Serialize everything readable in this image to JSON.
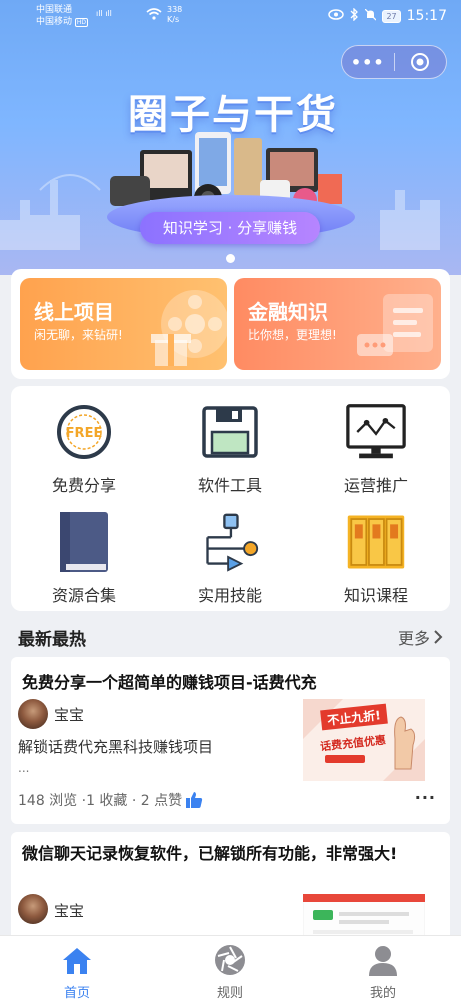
{
  "status_bar": {
    "carrier_1": "中国联通",
    "carrier_2": "中国移动",
    "hd": "HD",
    "speed_value": "338",
    "speed_unit": "K/s",
    "battery": "27",
    "time": "15:17"
  },
  "capsule": {
    "more_label": "•••"
  },
  "banner": {
    "title": "圈子与干货",
    "slogan": "知识学习 · 分享赚钱"
  },
  "promos": [
    {
      "title": "线上项目",
      "subtitle": "闲无聊，来钻研!"
    },
    {
      "title": "金融知识",
      "subtitle": "比你想，更理想!"
    }
  ],
  "categories": [
    {
      "label": "免费分享",
      "icon": "free-badge-icon",
      "badge": "FREE"
    },
    {
      "label": "软件工具",
      "icon": "floppy-disk-icon"
    },
    {
      "label": "运营推广",
      "icon": "monitor-chart-icon"
    },
    {
      "label": "资源合集",
      "icon": "book-icon"
    },
    {
      "label": "实用技能",
      "icon": "flowchart-icon"
    },
    {
      "label": "知识课程",
      "icon": "file-folders-icon"
    }
  ],
  "section": {
    "title": "最新最热",
    "more": "更多"
  },
  "articles": [
    {
      "title": "免费分享一个超简单的赚钱项目-话费代充",
      "author": "宝宝",
      "description": "解锁话费代充黑科技赚钱项目",
      "ellipsis": "...",
      "stats": "148 浏览 ·1 收藏 · 2 点赞",
      "thumb_text_1": "不止九折!",
      "thumb_text_2": "话费充值优惠"
    },
    {
      "title": "微信聊天记录恢复软件，已解锁所有功能，非常强大!",
      "author": "宝宝"
    }
  ],
  "tabs": [
    {
      "label": "首页",
      "icon": "home-icon",
      "active": true
    },
    {
      "label": "规则",
      "icon": "aperture-icon",
      "active": false
    },
    {
      "label": "我的",
      "icon": "user-icon",
      "active": false
    }
  ],
  "colors": {
    "accent": "#3b82f0",
    "promo_left": "#ffa24e",
    "promo_right": "#ff8b62",
    "folder": "#f5b324",
    "book": "#4c5a86"
  }
}
